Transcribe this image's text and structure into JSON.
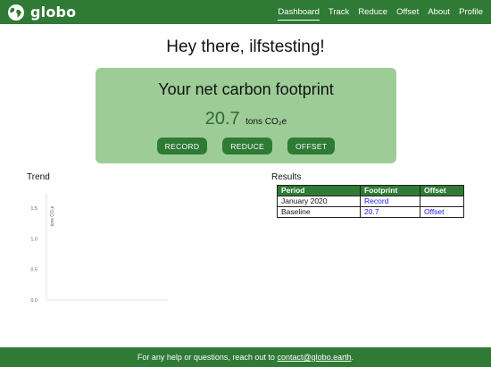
{
  "app": {
    "brand": "globo",
    "logo_icon": "globe-icon"
  },
  "nav": {
    "items": [
      {
        "label": "Dashboard",
        "active": true
      },
      {
        "label": "Track"
      },
      {
        "label": "Reduce"
      },
      {
        "label": "Offset"
      },
      {
        "label": "About"
      },
      {
        "label": "Profile"
      }
    ]
  },
  "greeting": "Hey there, ilfstesting!",
  "footprint": {
    "title": "Your net carbon footprint",
    "value": "20.7",
    "unit": "tons CO₂e",
    "buttons": {
      "record": "RECORD",
      "reduce": "REDUCE",
      "offset": "OFFSET"
    }
  },
  "trend": {
    "title": "Trend"
  },
  "chart_data": {
    "type": "line",
    "ylabel": "tons CO₂e",
    "yticks": [
      "1.5",
      "1.0",
      "0.5",
      "0.0"
    ],
    "ylim": [
      0,
      1.75
    ],
    "series": []
  },
  "results": {
    "title": "Results",
    "headers": [
      "Period",
      "Footprint",
      "Offset"
    ],
    "rows": [
      {
        "period": "January 2020",
        "footprint": "Record",
        "offset": ""
      },
      {
        "period": "Baseline",
        "footprint": "20.7",
        "offset": "Offset"
      }
    ]
  },
  "footer": {
    "text": "For any help or questions, reach out to ",
    "email": "contact@globo.earth",
    "suffix": "."
  },
  "colors": {
    "brand_green": "#2f7a35",
    "card_green": "#9dcc97",
    "link_blue": "#1a1aff"
  }
}
